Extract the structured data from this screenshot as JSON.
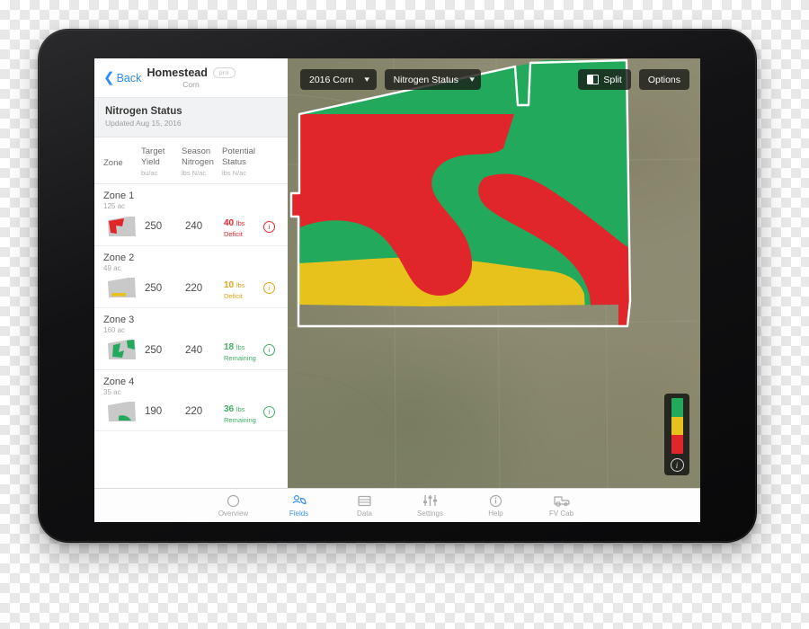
{
  "device": {
    "type": "tablet",
    "frame_color": "#0d0d0f"
  },
  "sidebar": {
    "back_label": "Back",
    "field_title": "Homestead",
    "pro_badge": "pro",
    "crop_label": "Corn",
    "status": {
      "title": "Nitrogen Status",
      "updated": "Updated Aug 15, 2016"
    },
    "columns": [
      {
        "label": "Zone",
        "unit": ""
      },
      {
        "label": "Target Yield",
        "unit": "bu/ac"
      },
      {
        "label": "Season Nitrogen",
        "unit": "lbs N/ac"
      },
      {
        "label": "Potential Status",
        "unit": "lbs N/ac"
      }
    ],
    "zones": [
      {
        "name": "Zone 1",
        "acres": "125 ac",
        "target_yield": "250",
        "season_nitrogen": "240",
        "status_value": "40",
        "status_unit": "lbs",
        "status_label": "Deficit",
        "status_color": "#e0262b",
        "thumb_color": "#e0262b",
        "thumb_type": "zone1"
      },
      {
        "name": "Zone 2",
        "acres": "49 ac",
        "target_yield": "250",
        "season_nitrogen": "220",
        "status_value": "10",
        "status_unit": "lbs",
        "status_label": "Deficit",
        "status_color": "#e0a41b",
        "thumb_color": "#e8c21c",
        "thumb_type": "zone2"
      },
      {
        "name": "Zone 3",
        "acres": "160 ac",
        "target_yield": "250",
        "season_nitrogen": "240",
        "status_value": "18",
        "status_unit": "lbs",
        "status_label": "Remaining",
        "status_color": "#3fad63",
        "thumb_color": "#22a95c",
        "thumb_type": "zone3"
      },
      {
        "name": "Zone 4",
        "acres": "35 ac",
        "target_yield": "190",
        "season_nitrogen": "220",
        "status_value": "36",
        "status_unit": "lbs",
        "status_label": "Remaining",
        "status_color": "#3fad63",
        "thumb_color": "#22a95c",
        "thumb_type": "zone4"
      }
    ]
  },
  "map": {
    "toolbar": {
      "season_select": "2016 Corn",
      "layer_select": "Nitrogen Status",
      "split_label": "Split",
      "options_label": "Options"
    },
    "legend": {
      "colors": [
        "#22a95c",
        "#e8c21c",
        "#e0262b"
      ],
      "info_glyph": "i"
    },
    "field_colors": {
      "green": "#22a95c",
      "yellow": "#e8c21c",
      "red": "#e0262b",
      "boundary": "#ffffff"
    }
  },
  "tabbar": {
    "tabs": [
      {
        "label": "Overview",
        "icon": "circle-icon",
        "active": false
      },
      {
        "label": "Fields",
        "icon": "fields-icon",
        "active": true
      },
      {
        "label": "Data",
        "icon": "data-icon",
        "active": false
      },
      {
        "label": "Settings",
        "icon": "sliders-icon",
        "active": false
      },
      {
        "label": "Help",
        "icon": "info-icon",
        "active": false
      },
      {
        "label": "FV Cab",
        "icon": "tractor-icon",
        "active": false
      }
    ]
  }
}
